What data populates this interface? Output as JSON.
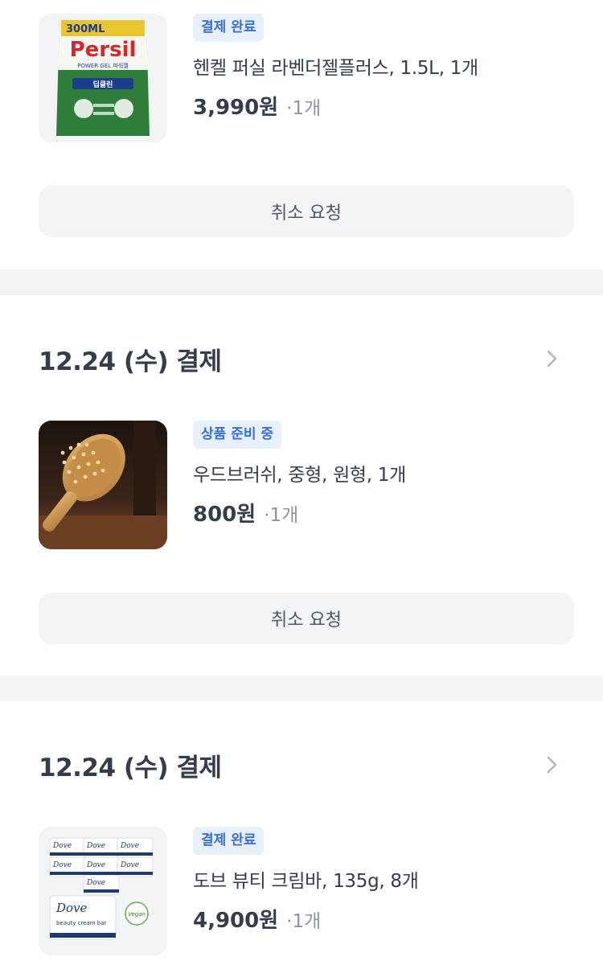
{
  "orders": [
    {
      "item": {
        "status_badge": "결제 완료",
        "name": "헨켈 퍼실 라벤더젤플러스, 1.5L, 1개",
        "price": "3,990원",
        "quantity": "·1개",
        "image_icon": "persil-detergent-image",
        "image_text": {
          "top": "300ML",
          "brand": "Persil",
          "line": "POWER GEL 파워젤",
          "sub": "딥클린"
        }
      },
      "cancel_label": "취소 요청"
    },
    {
      "date_title": "12.24 (수) 결제",
      "item": {
        "status_badge": "상품 준비 중",
        "name": "우드브러쉬, 중형, 원형, 1개",
        "price": "800원",
        "quantity": "·1개",
        "image_icon": "wooden-hairbrush-image"
      },
      "cancel_label": "취소 요청"
    },
    {
      "date_title": "12.24 (수) 결제",
      "item": {
        "status_badge": "결제 완료",
        "name": "도브 뷰티 크림바, 135g, 8개",
        "price": "4,900원",
        "quantity": "·1개",
        "image_icon": "dove-soap-bars-image",
        "image_text": {
          "brand": "Dove",
          "line": "beauty cream bar",
          "vegan": "Vegan"
        }
      }
    }
  ],
  "colors": {
    "badge_bg": "#e8f0fd",
    "badge_text": "#3770db",
    "section_gap": "#f2f4f6",
    "button_bg": "#f2f4f6"
  }
}
